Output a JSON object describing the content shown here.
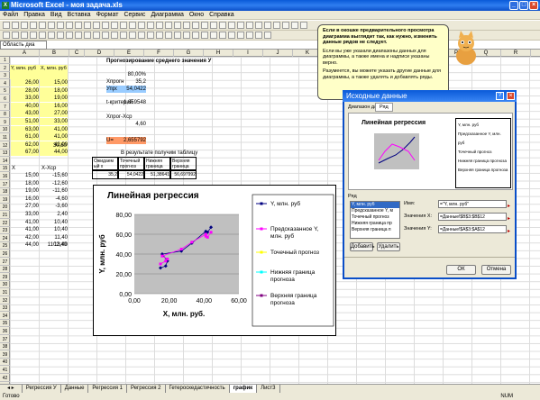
{
  "window": {
    "title": "Microsoft Excel - моя задача.xls",
    "app_icon": "excel-icon"
  },
  "menu": [
    "Файл",
    "Правка",
    "Вид",
    "Вставка",
    "Формат",
    "Сервис",
    "Диаграмма",
    "Окно",
    "Справка"
  ],
  "formula_bar": {
    "name_box": "Область диа"
  },
  "columns": [
    "A",
    "B",
    "C",
    "D",
    "E",
    "F",
    "G",
    "H",
    "I",
    "J",
    "K",
    "L",
    "M",
    "N",
    "O",
    "P",
    "Q",
    "R",
    "S"
  ],
  "rows": [
    "1",
    "2",
    "3",
    "4",
    "5",
    "6",
    "7",
    "8",
    "9",
    "10",
    "11",
    "12",
    "13",
    "14",
    "15",
    "16",
    "17",
    "18",
    "19",
    "20",
    "21",
    "22",
    "23",
    "24",
    "25",
    "26",
    "27",
    "28",
    "29",
    "30",
    "31",
    "32",
    "33",
    "34",
    "35",
    "36",
    "37",
    "38",
    "39",
    "40",
    "41",
    "42"
  ],
  "sheet": {
    "col_a_header": "Y, млн. руб",
    "col_b_header": "X, млн. руб",
    "col_a_values": [
      "26,00",
      "28,00",
      "33,00",
      "40,00",
      "43,00",
      "51,00",
      "63,00",
      "61,00",
      "62,00",
      "67,00"
    ],
    "col_b_values": [
      "15,00",
      "18,00",
      "19,00",
      "16,00",
      "27,00",
      "33,00",
      "41,00",
      "41,00",
      "42,00",
      "44,00"
    ],
    "b13": "30,60",
    "forecast_title": "Прогнозирование среднего значения У",
    "pct": "80,00%",
    "xprog_label": "Хпрогн",
    "xprog_value": "35,2",
    "yprog_label": "Упрогн",
    "yprog_value": "54,0422",
    "tcrit_label": "t-критерий",
    "tcrit_value": "1,859548",
    "xdiff_label": "Хпрог-Хср",
    "xdiff_value": "4,60",
    "u_label": "U=",
    "u_value": "2,655792",
    "result_title": "В результате получим таблицу",
    "result_headers": [
      "Ожидаем ый х",
      "Точечный прогноз",
      "Нижняя граница",
      "Верхняя граница"
    ],
    "result_values": [
      "35,2",
      "54,0422",
      "51,38641",
      "56,697992"
    ],
    "lower_a_header": "X",
    "lower_b_header": "X-Xср",
    "lower_a_values": [
      "15,00",
      "18,00",
      "19,00",
      "16,00",
      "27,00",
      "33,00",
      "41,00",
      "41,00",
      "42,00",
      "44,00"
    ],
    "lower_b_values": [
      "-15,60",
      "-12,60",
      "-11,60",
      "-4,60",
      "-3,60",
      "2,40",
      "10,40",
      "10,40",
      "11,40",
      "13,40"
    ],
    "b26": "1102,40"
  },
  "chart_data": {
    "type": "scatter",
    "title": "Линейная регрессия",
    "xlabel": "X, млн. руб.",
    "ylabel": "Y, млн. руб",
    "xlim": [
      0,
      60
    ],
    "ylim": [
      0,
      80
    ],
    "x_ticks": [
      "0,00",
      "20,00",
      "40,00",
      "60,00"
    ],
    "y_ticks": [
      "0,00",
      "20,00",
      "40,00",
      "60,00",
      "80,00"
    ],
    "series": [
      {
        "name": "Y, млн. руб",
        "color": "#000080",
        "x": [
          15,
          18,
          19,
          16,
          27,
          33,
          41,
          41,
          42,
          44
        ],
        "y": [
          26,
          28,
          33,
          40,
          43,
          51,
          63,
          61,
          62,
          67
        ]
      },
      {
        "name": "Предсказанное Y, млн. руб",
        "color": "#ff00ff",
        "x": [
          15,
          18,
          19,
          16,
          27,
          33,
          41,
          41,
          42,
          44
        ],
        "y": [
          30,
          33,
          35,
          38,
          45,
          52,
          60,
          58,
          57,
          62
        ]
      }
    ],
    "legend": [
      "Y, млн. руб",
      "Предсказанное Y, млн. руб",
      "Точечный прогноз",
      "Нижняя граница прогноза",
      "Верхняя граница прогноза"
    ],
    "legend_placement": "right"
  },
  "balloon": {
    "p1": "Если в окошке предварительного просмотра диаграмма выглядит так, как нужно, изменять данные рядов не следует.",
    "p2": "Если вы уже указали диапазоны данных для диаграммы, а также имена и надписи указаны верно.",
    "p3": "Разумеется, вы можете указать другие данные для диаграммы, а также удалять и добавлять ряды."
  },
  "dialog": {
    "title": "Исходные данные",
    "tabs": [
      "Диапазон данных",
      "Ряд"
    ],
    "preview_title": "Линейная регрессия",
    "series_label": "Ряд",
    "series_list": [
      "Y, млн. руб",
      "Предсказанное Y, м",
      "Точечный прогноз",
      "Нижняя граница пр",
      "Верхняя граница п"
    ],
    "name_label": "Имя:",
    "name_value": "=\"Y, млн. руб\"",
    "x_label": "Значения X:",
    "x_value": "=Данные!$B$3:$B$12",
    "y_label": "Значения Y:",
    "y_value": "=Данные!$A$3:$A$12",
    "add": "Добавить",
    "delete": "Удалить",
    "ok": "ОК",
    "cancel": "Отмена"
  },
  "sheet_tabs": [
    "Регрессия У",
    "Данные",
    "Регрессия 1",
    "Регрессия 2",
    "Гетероскедастичность",
    "график",
    "Лист3"
  ],
  "status": {
    "left": "Готово",
    "right": "NUM"
  }
}
